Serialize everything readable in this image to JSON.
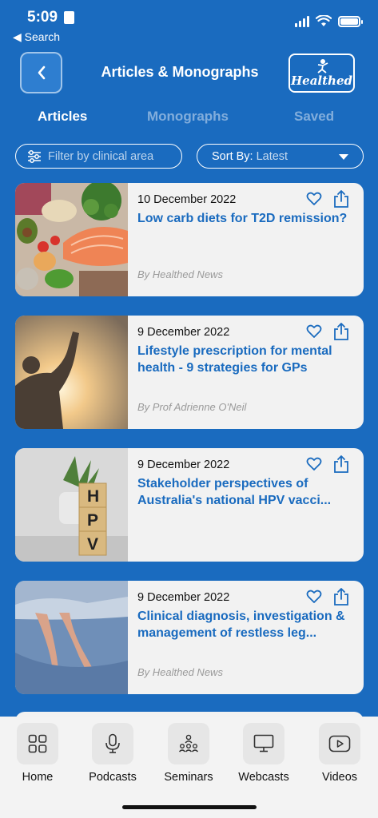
{
  "status_bar": {
    "time": "5:09",
    "back_label": "◀ Search"
  },
  "header": {
    "back_icon": "chevron-left-icon",
    "title": "Articles & Monographs",
    "logo_text": "Healthed"
  },
  "tabs": [
    {
      "label": "Articles",
      "active": true
    },
    {
      "label": "Monographs",
      "active": false
    },
    {
      "label": "Saved",
      "active": false
    }
  ],
  "filters": {
    "filter_placeholder": "Filter by clinical area",
    "sort_label": "Sort By:",
    "sort_value": "Latest"
  },
  "articles": [
    {
      "date": "10 December 2022",
      "title": "Low carb diets for T2D remission?",
      "author": "By Healthed News",
      "image": "food-photo"
    },
    {
      "date": "9 December 2022",
      "title": "Lifestyle prescription for mental health - 9 strategies for GPs",
      "author": "By Prof Adrienne O'Neil",
      "image": "fitness-photo"
    },
    {
      "date": "9 December 2022",
      "title": "Stakeholder perspectives of Australia's national HPV vacci...",
      "author": "",
      "image": "hpv-blocks-photo"
    },
    {
      "date": "9 December 2022",
      "title": "Clinical diagnosis, investigation & management of restless leg...",
      "author": "By Healthed News",
      "image": "legs-bed-photo"
    }
  ],
  "bottom_nav": [
    {
      "label": "Home",
      "icon": "grid-icon"
    },
    {
      "label": "Podcasts",
      "icon": "microphone-icon"
    },
    {
      "label": "Seminars",
      "icon": "people-icon"
    },
    {
      "label": "Webcasts",
      "icon": "monitor-icon"
    },
    {
      "label": "Videos",
      "icon": "play-icon"
    }
  ],
  "colors": {
    "primary": "#1a6bbf",
    "card_bg": "#f2f2f2",
    "nav_bg": "#f3f3f3"
  }
}
